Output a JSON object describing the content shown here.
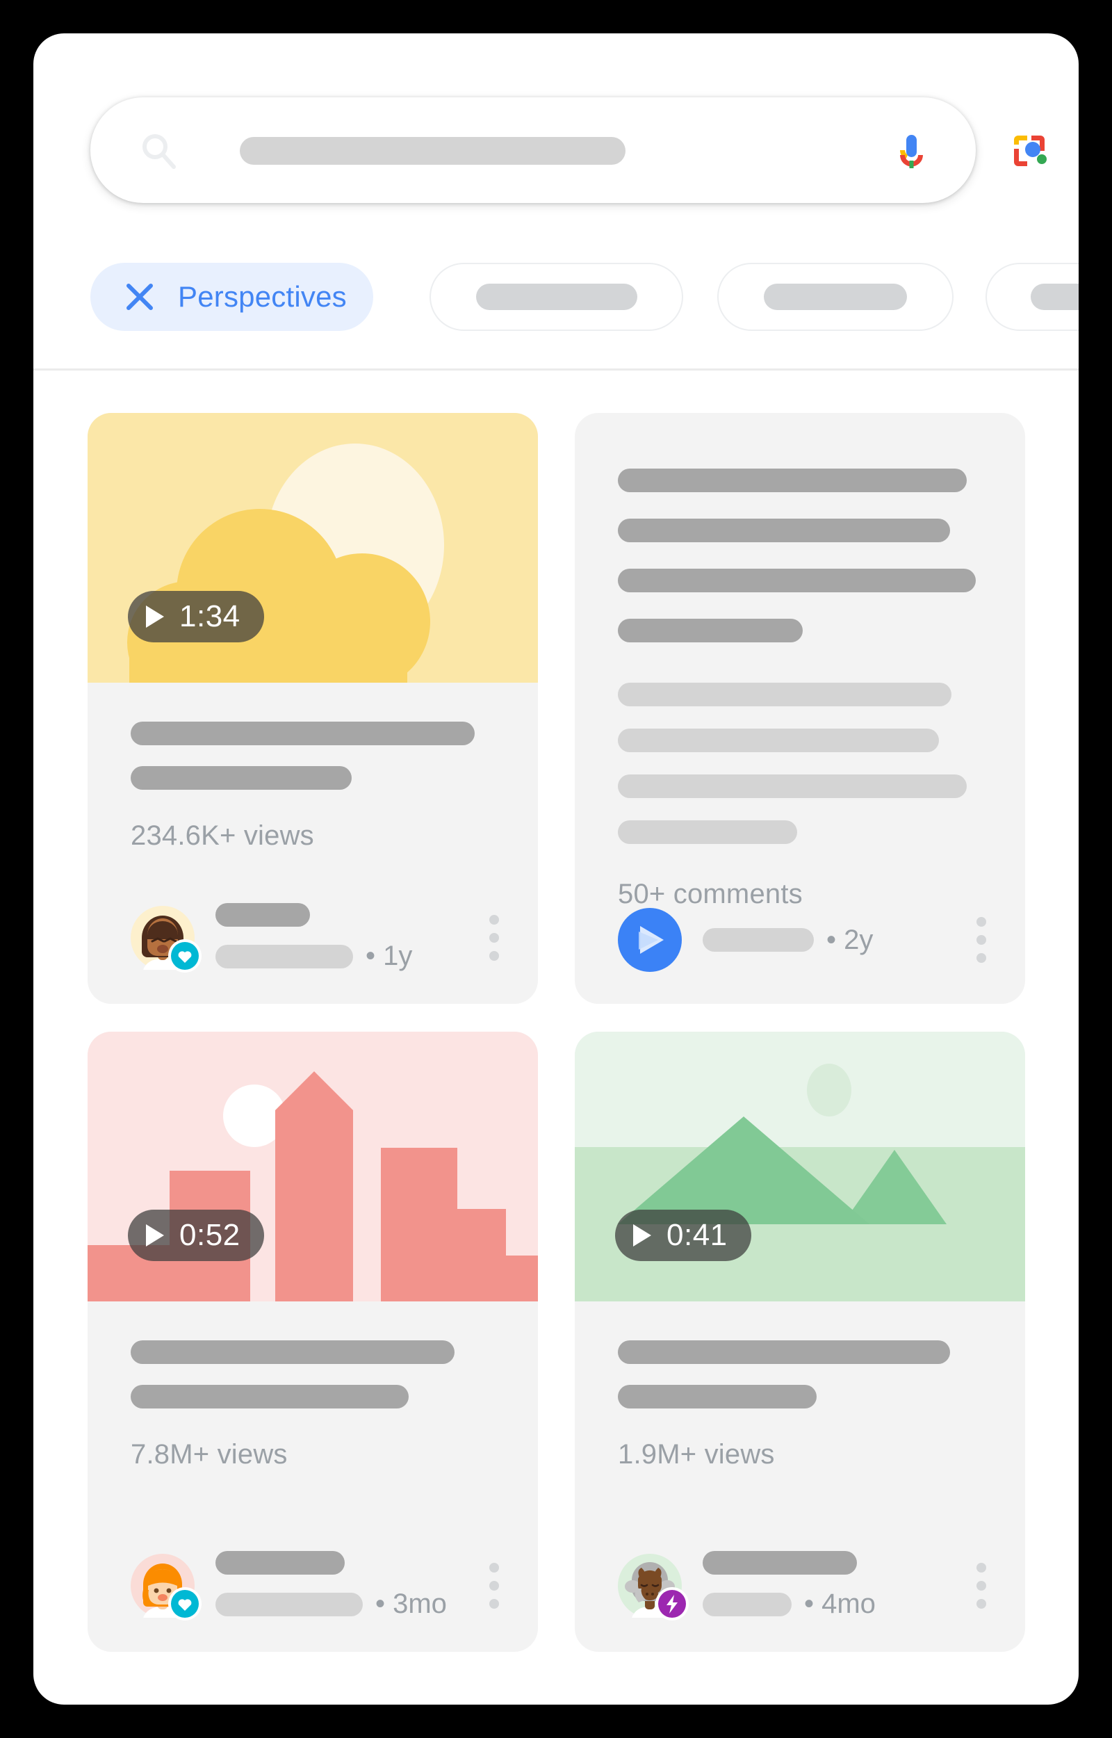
{
  "frame": {
    "background": "#000000",
    "panel_background": "#ffffff"
  },
  "search": {
    "icon": "search-icon",
    "placeholder": "",
    "value": "",
    "mic_icon": "microphone-icon",
    "lens_icon": "google-lens-icon",
    "colors": {
      "blue": "#4285f4",
      "red": "#ea4335",
      "yellow": "#fbbc04",
      "green": "#34a853"
    }
  },
  "filters": {
    "active": {
      "label": "Perspectives",
      "icon": "close-x-icon",
      "color": "#4285f4",
      "background": "#e8f0fe"
    },
    "placeholders": [
      {
        "label": "",
        "name": "filter-chip-2"
      },
      {
        "label": "",
        "name": "filter-chip-3"
      },
      {
        "label": "",
        "name": "filter-chip-4"
      }
    ]
  },
  "results": [
    {
      "type": "video",
      "thumbnail": "sun-and-clouds-illustration",
      "duration": "1:34",
      "play_icon": "play-icon",
      "stat": "234.6K+ views",
      "avatar": "woman-dark-hair-avatar",
      "avatar_badge": "heart-badge-icon",
      "avatar_badge_color": "#00b8d4",
      "time": "• 1y",
      "menu_icon": "more-vert-icon"
    },
    {
      "type": "text",
      "stat": "50+ comments",
      "avatar": "blue-play-star-avatar",
      "avatar_color": "#4285f4",
      "time": "• 2y",
      "menu_icon": "more-vert-icon"
    },
    {
      "type": "video",
      "thumbnail": "pink-cityscape-illustration",
      "duration": "0:52",
      "play_icon": "play-icon",
      "stat": "7.8M+ views",
      "avatar": "orange-hair-woman-avatar",
      "avatar_badge": "heart-badge-icon",
      "avatar_badge_color": "#00b8d4",
      "time": "• 3mo",
      "menu_icon": "more-vert-icon"
    },
    {
      "type": "video",
      "thumbnail": "green-mountains-illustration",
      "duration": "0:41",
      "play_icon": "play-icon",
      "stat": "1.9M+ views",
      "avatar": "bull-avatar",
      "avatar_badge": "lightning-bolt-badge-icon",
      "avatar_badge_color": "#9c27b0",
      "time": "• 4mo",
      "menu_icon": "more-vert-icon"
    }
  ]
}
